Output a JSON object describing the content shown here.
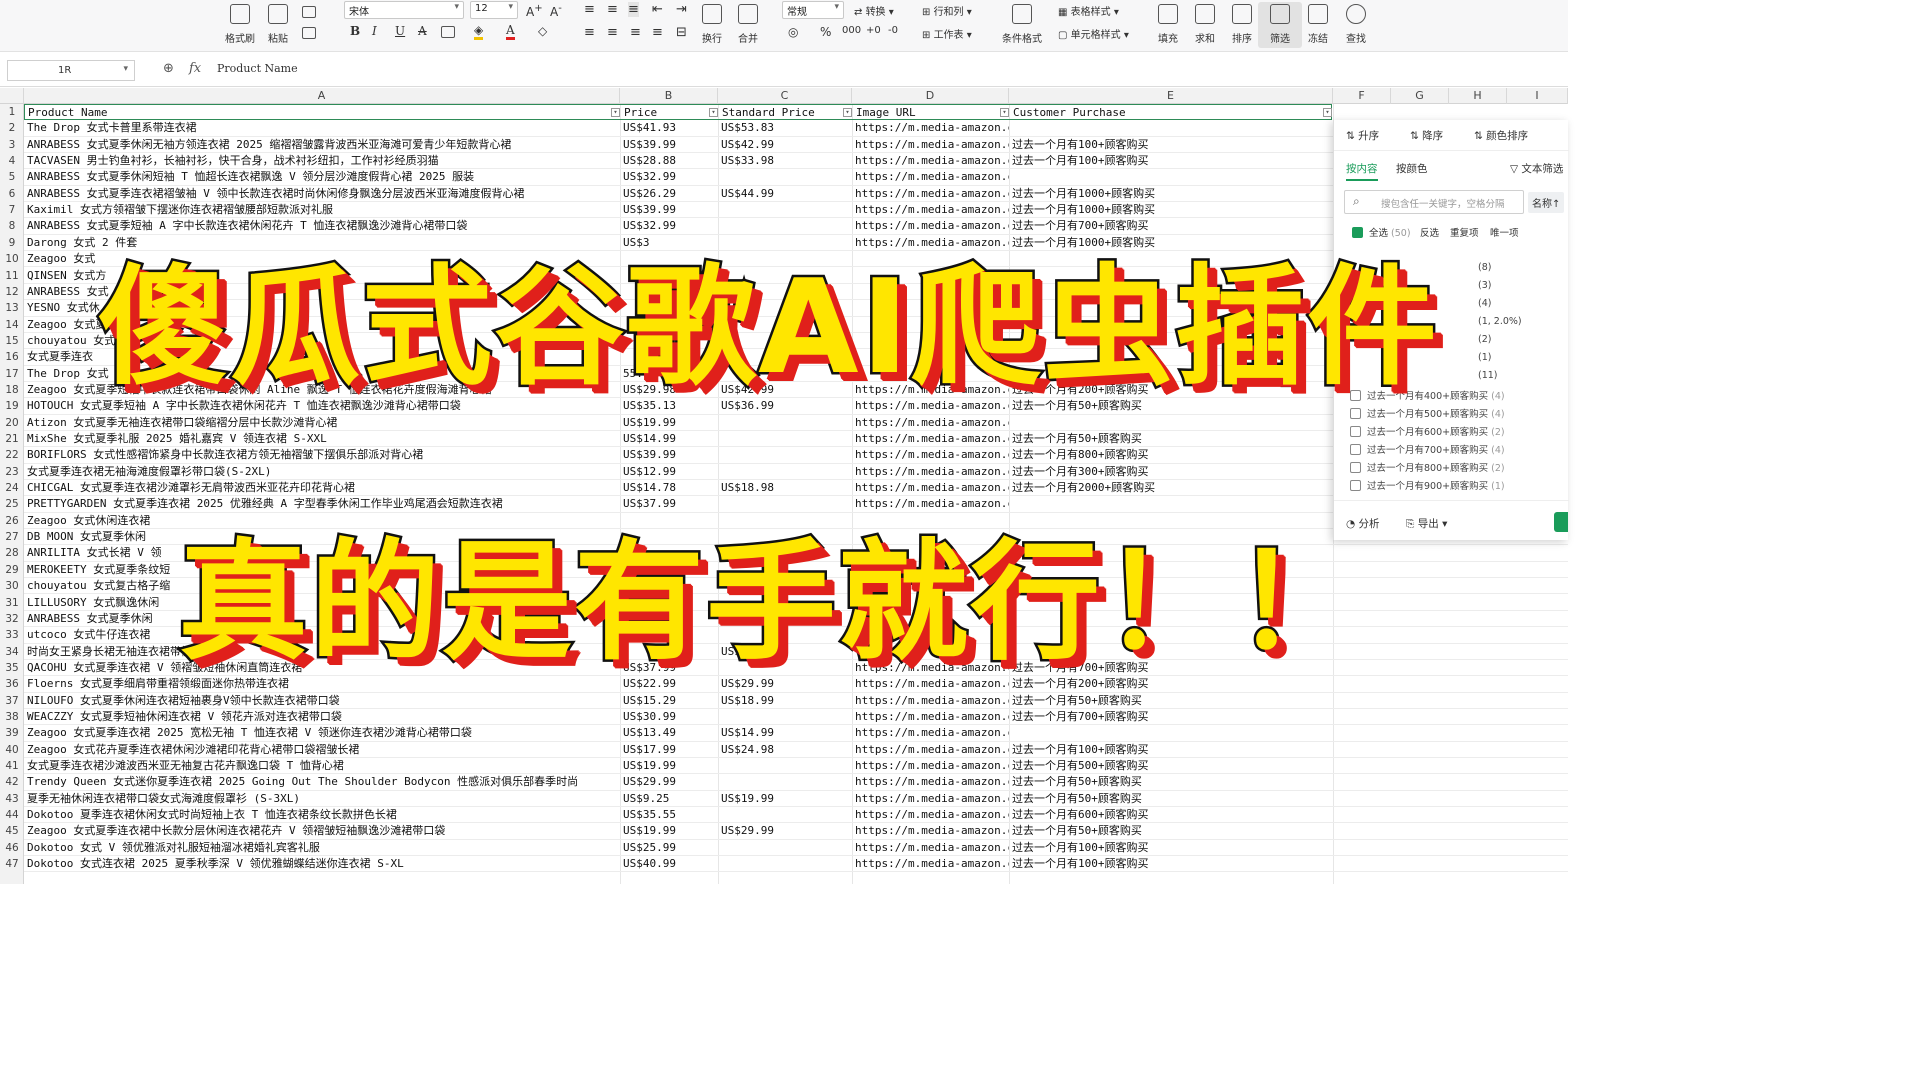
{
  "ribbon": {
    "buttons": [
      {
        "label": "格式刷",
        "icon": "format-painter-icon"
      },
      {
        "label": "粘贴",
        "icon": "paste-icon"
      },
      {
        "label": "",
        "icon": "copy-icon"
      },
      {
        "label": "换行",
        "icon": "wrap-icon"
      },
      {
        "label": "合并",
        "icon": "merge-icon"
      },
      {
        "label": "条件格式",
        "icon": "conditional-format-icon"
      },
      {
        "label": "填充",
        "icon": "fill-icon"
      },
      {
        "label": "求和",
        "icon": "sum-icon"
      },
      {
        "label": "排序",
        "icon": "sort-icon"
      },
      {
        "label": "筛选",
        "icon": "filter-icon"
      },
      {
        "label": "冻结",
        "icon": "freeze-icon"
      },
      {
        "label": "查找",
        "icon": "find-icon"
      }
    ],
    "font_name": "宋体",
    "font_size": "12",
    "number_format": "常规",
    "convert_label": "转换",
    "rowcol_label": "行和列",
    "table_style_label": "表格样式",
    "worksheet_label": "工作表",
    "cell_style_label": "单元格样式"
  },
  "formula_bar": {
    "name_box": "1R",
    "fx": "fx",
    "content": "Product Name"
  },
  "columns": [
    "A",
    "B",
    "C",
    "D",
    "E",
    "F",
    "G",
    "H",
    "I"
  ],
  "header": {
    "product": "Product Name",
    "price": "Price",
    "standard_price": "Standard Price",
    "image_url": "Image URL",
    "customer_purchase": "Customer Purchase"
  },
  "rows": [
    {
      "n": "2",
      "a": "The Drop 女式卡普里系带连衣裙",
      "b": "US$41.93",
      "c": "US$53.83",
      "d": "https://m.media-amazon.c",
      "e": ""
    },
    {
      "n": "3",
      "a": "ANRABESS 女式夏季休闲无袖方领连衣裙 2025 缩褶褶皱露背波西米亚海滩可爱青少年短款背心裙",
      "b": "US$39.99",
      "c": "US$42.99",
      "d": "https://m.media-amazon.c",
      "e": "过去一个月有100+顾客购买"
    },
    {
      "n": "4",
      "a": "TACVASEN 男士钓鱼衬衫，长袖衬衫，快干合身，战术衬衫纽扣，工作衬衫经质羽猫",
      "b": "US$28.88",
      "c": "US$33.98",
      "d": "https://m.media-amazon.c",
      "e": "过去一个月有100+顾客购买"
    },
    {
      "n": "5",
      "a": "ANRABESS 女式夏季休闲短袖 T 恤超长连衣裙飘逸 V 领分层沙滩度假背心裙 2025 服装",
      "b": "US$32.99",
      "c": "",
      "d": "https://m.media-amazon.c",
      "e": ""
    },
    {
      "n": "6",
      "a": "ANRABESS 女式夏季连衣裙褶皱袖 V 领中长款连衣裙时尚休闲修身飘逸分层波西米亚海滩度假背心裙",
      "b": "US$26.29",
      "c": "US$44.99",
      "d": "https://m.media-amazon.c",
      "e": "过去一个月有1000+顾客购买"
    },
    {
      "n": "7",
      "a": "Kaximil 女式方领褶皱下摆迷你连衣裙褶皱腰部短款派对礼服",
      "b": "US$39.99",
      "c": "",
      "d": "https://m.media-amazon.c",
      "e": "过去一个月有1000+顾客购买"
    },
    {
      "n": "8",
      "a": "ANRABESS 女式夏季短袖 A 字中长款连衣裙休闲花卉 T 恤连衣裙飘逸沙滩背心裙带口袋",
      "b": "US$32.99",
      "c": "",
      "d": "https://m.media-amazon.c",
      "e": "过去一个月有700+顾客购买"
    },
    {
      "n": "9",
      "a": "Darong 女式 2 件套",
      "b": "US$3",
      "c": "",
      "d": "https://m.media-amazon.c",
      "e": "过去一个月有1000+顾客购买"
    },
    {
      "n": "10",
      "a": "Zeagoo 女式",
      "b": "",
      "c": "",
      "d": "",
      "e": ""
    },
    {
      "n": "11",
      "a": "QINSEN 女式方",
      "b": "",
      "c": "",
      "d": "",
      "e": ""
    },
    {
      "n": "12",
      "a": "ANRABESS 女式",
      "b": "",
      "c": "",
      "d": "",
      "e": ""
    },
    {
      "n": "13",
      "a": "YESNO 女式休",
      "b": "",
      "c": "",
      "d": "",
      "e": ""
    },
    {
      "n": "14",
      "a": "Zeagoo 女式夏",
      "b": "",
      "c": "",
      "d": "",
      "e": ""
    },
    {
      "n": "15",
      "a": "chouyatou 女式",
      "b": "",
      "c": "",
      "d": "",
      "e": ""
    },
    {
      "n": "16",
      "a": "女式夏季连衣",
      "b": "",
      "c": "",
      "d": "",
      "e": ""
    },
    {
      "n": "17",
      "a": "The Drop 女式",
      "b": "55.93",
      "c": "",
      "d": "",
      "e": ""
    },
    {
      "n": "18",
      "a": "Zeagoo 女式夏季短袖中长款连衣裙带口袋休闲 Aline 飘逸 T 恤连衣裙花卉度假海滩背心裙",
      "b": "US$29.98",
      "c": "US$42.99",
      "d": "https://m.media-amazon.c",
      "e": "过去一个月有200+顾客购买"
    },
    {
      "n": "19",
      "a": "HOTOUCH 女式夏季短袖 A 字中长款连衣裙休闲花卉 T 恤连衣裙飘逸沙滩背心裙带口袋",
      "b": "US$35.13",
      "c": "US$36.99",
      "d": "https://m.media-amazon.c",
      "e": "过去一个月有50+顾客购买"
    },
    {
      "n": "20",
      "a": "Atizon 女式夏季无袖连衣裙带口袋缩褶分层中长款沙滩背心裙",
      "b": "US$19.99",
      "c": "",
      "d": "https://m.media-amazon.c",
      "e": ""
    },
    {
      "n": "21",
      "a": "MixShe 女式夏季礼服 2025 婚礼嘉宾 V 领连衣裙 S-XXL",
      "b": "US$14.99",
      "c": "",
      "d": "https://m.media-amazon.c",
      "e": "过去一个月有50+顾客购买"
    },
    {
      "n": "22",
      "a": "BORIFLORS 女式性感褶饰紧身中长款连衣裙方领无袖褶皱下摆俱乐部派对背心裙",
      "b": "US$39.99",
      "c": "",
      "d": "https://m.media-amazon.c",
      "e": "过去一个月有800+顾客购买"
    },
    {
      "n": "23",
      "a": "女式夏季连衣裙无袖海滩度假罩衫带口袋(S-2XL)",
      "b": "US$12.99",
      "c": "",
      "d": "https://m.media-amazon.c",
      "e": "过去一个月有300+顾客购买"
    },
    {
      "n": "24",
      "a": "CHICGAL 女式夏季连衣裙沙滩罩衫无肩带波西米亚花卉印花背心裙",
      "b": "US$14.78",
      "c": "US$18.98",
      "d": "https://m.media-amazon.c",
      "e": "过去一个月有2000+顾客购买"
    },
    {
      "n": "25",
      "a": "PRETTYGARDEN 女式夏季连衣裙 2025 优雅经典 A 字型春季休闲工作毕业鸡尾酒会短款连衣裙",
      "b": "US$37.99",
      "c": "",
      "d": "https://m.media-amazon.c",
      "e": ""
    },
    {
      "n": "26",
      "a": "Zeagoo 女式休闲连衣裙",
      "b": "",
      "c": "",
      "d": "",
      "e": ""
    },
    {
      "n": "27",
      "a": "DB MOON 女式夏季休闲",
      "b": "",
      "c": "",
      "d": "",
      "e": ""
    },
    {
      "n": "28",
      "a": "ANRILITA 女式长裙 V 领",
      "b": "",
      "c": "",
      "d": "",
      "e": ""
    },
    {
      "n": "29",
      "a": "MEROKEETY 女式夏季条纹短",
      "b": "",
      "c": "",
      "d": "",
      "e": ""
    },
    {
      "n": "30",
      "a": "chouyatou 女式复古格子缩",
      "b": "",
      "c": "",
      "d": "",
      "e": ""
    },
    {
      "n": "31",
      "a": "LILLUSORY 女式飘逸休闲",
      "b": "",
      "c": "",
      "d": "",
      "e": ""
    },
    {
      "n": "32",
      "a": "ANRABESS 女式夏季休闲",
      "b": "",
      "c": "",
      "d": "",
      "e": ""
    },
    {
      "n": "33",
      "a": "utcoco 女式牛仔连衣裙",
      "b": "US$",
      "c": "",
      "d": "",
      "e": ""
    },
    {
      "n": "34",
      "a": "时尚女王紧身长裙无袖连衣裙带侧",
      "b": "",
      "c": "US$34.",
      "d": "",
      "e": ""
    },
    {
      "n": "35",
      "a": "QACOHU 女式夏季连衣裙 V 领褶皱短袖休闲直筒连衣裙",
      "b": "US$37.99",
      "c": "",
      "d": "https://m.media-amazon.c",
      "e": "过去一个月有700+顾客购买"
    },
    {
      "n": "36",
      "a": "Floerns 女式夏季细肩带重褶领缎面迷你热带连衣裙",
      "b": "US$22.99",
      "c": "US$29.99",
      "d": "https://m.media-amazon.c",
      "e": "过去一个月有200+顾客购买"
    },
    {
      "n": "37",
      "a": "NILOUFO 女式夏季休闲连衣裙短袖裹身V领中长款连衣裙带口袋",
      "b": "US$15.29",
      "c": "US$18.99",
      "d": "https://m.media-amazon.c",
      "e": "过去一个月有50+顾客购买"
    },
    {
      "n": "38",
      "a": "WEACZZY 女式夏季短袖休闲连衣裙 V 领花卉派对连衣裙带口袋",
      "b": "US$30.99",
      "c": "",
      "d": "https://m.media-amazon.c",
      "e": "过去一个月有700+顾客购买"
    },
    {
      "n": "39",
      "a": "Zeagoo 女式夏季连衣裙 2025 宽松无袖 T 恤连衣裙 V 领迷你连衣裙沙滩背心裙带口袋",
      "b": "US$13.49",
      "c": "US$14.99",
      "d": "https://m.media-amazon.c",
      "e": ""
    },
    {
      "n": "40",
      "a": "Zeagoo 女式花卉夏季连衣裙休闲沙滩裙印花背心裙带口袋褶皱长裙",
      "b": "US$17.99",
      "c": "US$24.98",
      "d": "https://m.media-amazon.c",
      "e": "过去一个月有100+顾客购买"
    },
    {
      "n": "41",
      "a": "女式夏季连衣裙沙滩波西米亚无袖复古花卉飘逸口袋 T 恤背心裙",
      "b": "US$19.99",
      "c": "",
      "d": "https://m.media-amazon.c",
      "e": "过去一个月有500+顾客购买"
    },
    {
      "n": "42",
      "a": "Trendy Queen 女式迷你夏季连衣裙 2025 Going Out The Shoulder Bodycon 性感派对俱乐部春季时尚",
      "b": "US$29.99",
      "c": "",
      "d": "https://m.media-amazon.c",
      "e": "过去一个月有50+顾客购买"
    },
    {
      "n": "43",
      "a": "夏季无袖休闲连衣裙带口袋女式海滩度假罩衫 (S-3XL)",
      "b": "US$9.25",
      "c": "US$19.99",
      "d": "https://m.media-amazon.c",
      "e": "过去一个月有50+顾客购买"
    },
    {
      "n": "44",
      "a": "Dokotoo 夏季连衣裙休闲女式时尚短袖上衣 T 恤连衣裙条纹长款拼色长裙",
      "b": "US$35.55",
      "c": "",
      "d": "https://m.media-amazon.c",
      "e": "过去一个月有600+顾客购买"
    },
    {
      "n": "45",
      "a": "Zeagoo 女式夏季连衣裙中长款分层休闲连衣裙花卉 V 领褶皱短袖飘逸沙滩裙带口袋",
      "b": "US$19.99",
      "c": "US$29.99",
      "d": "https://m.media-amazon.c",
      "e": "过去一个月有50+顾客购买"
    },
    {
      "n": "46",
      "a": "Dokotoo 女式 V 领优雅派对礼服短袖溜冰裙婚礼宾客礼服",
      "b": "US$25.99",
      "c": "",
      "d": "https://m.media-amazon.c",
      "e": "过去一个月有100+顾客购买"
    },
    {
      "n": "47",
      "a": "Dokotoo 女式连衣裙 2025 夏季秋季深 V 领优雅蝴蝶结迷你连衣裙 S-XL",
      "b": "US$40.99",
      "c": "",
      "d": "https://m.media-amazon.c",
      "e": "过去一个月有100+顾客购买"
    }
  ],
  "filter_panel": {
    "sort_asc": "升序",
    "sort_desc": "降序",
    "sort_color": "颜色排序",
    "tab_content": "按内容",
    "tab_color": "按颜色",
    "text_filter": "文本筛选",
    "search_placeholder": "搜包含任一关键字，空格分隔",
    "sort_by_name": "名称↑",
    "select_all": "全选",
    "select_all_count": "(50)",
    "invert": "反选",
    "duplicates": "重复项",
    "unique": "唯一项",
    "items": [
      {
        "label": "过去一个月有400+顾客购买",
        "count": "(4)",
        "checked": false
      },
      {
        "label": "过去一个月有500+顾客购买",
        "count": "(4)",
        "checked": false
      },
      {
        "label": "过去一个月有600+顾客购买",
        "count": "(2)",
        "checked": false
      },
      {
        "label": "过去一个月有700+顾客购买",
        "count": "(4)",
        "checked": false
      },
      {
        "label": "过去一个月有800+顾客购买",
        "count": "(2)",
        "checked": false
      },
      {
        "label": "过去一个月有900+顾客购买",
        "count": "(1)",
        "checked": false
      }
    ],
    "partial_counts": [
      "(8)",
      "(3)",
      "(4)",
      "(1, 2.0%)",
      "(2)",
      "(1)",
      "(11)"
    ],
    "analyze": "分析",
    "export": "导出"
  },
  "overlay": {
    "line1": "傻瓜式谷歌AI爬虫插件",
    "line2": "真的是有手就行！！"
  },
  "colors": {
    "caption_fill": "#ffe600",
    "caption_shadow": "#e0201b",
    "accent": "#1a9c5a"
  }
}
